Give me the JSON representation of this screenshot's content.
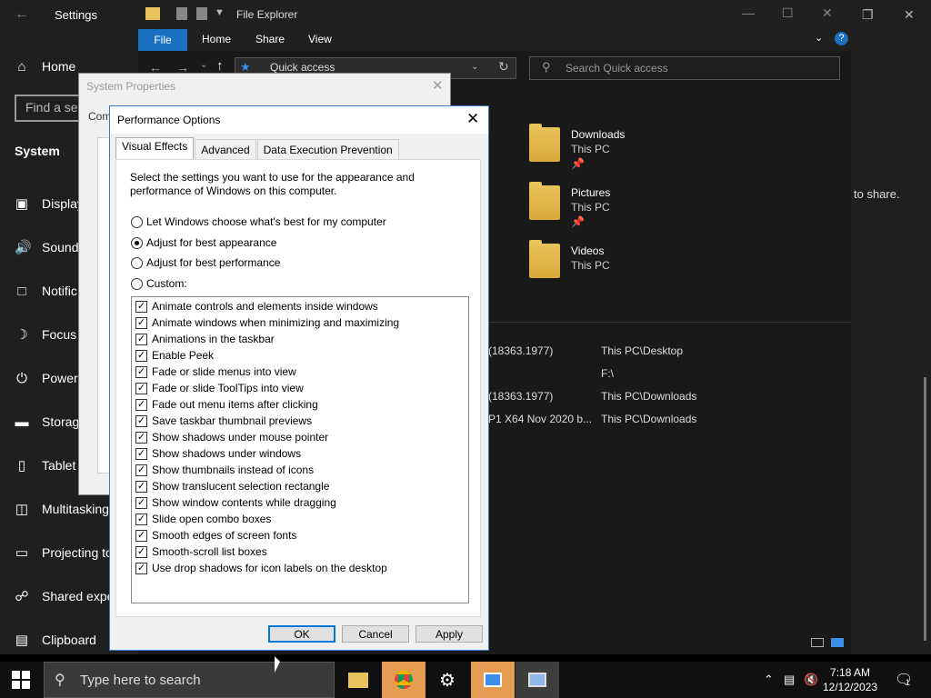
{
  "settings": {
    "title": "Settings",
    "home": "Home",
    "search_placeholder": "Find a set",
    "section": "System",
    "nav": [
      {
        "label": "Display",
        "icon": "display-icon"
      },
      {
        "label": "Sound",
        "icon": "sound-icon"
      },
      {
        "label": "Notific",
        "icon": "notifications-icon"
      },
      {
        "label": "Focus",
        "icon": "focus-assist-icon"
      },
      {
        "label": "Power",
        "icon": "power-icon"
      },
      {
        "label": "Storag",
        "icon": "storage-icon"
      },
      {
        "label": "Tablet",
        "icon": "tablet-icon"
      },
      {
        "label": "Multitasking",
        "icon": "multitasking-icon"
      },
      {
        "label": "Projecting to",
        "icon": "projecting-icon"
      },
      {
        "label": "Shared expe",
        "icon": "shared-experiences-icon"
      },
      {
        "label": "Clipboard",
        "icon": "clipboard-icon"
      }
    ],
    "share_hint": "to share."
  },
  "explorer": {
    "title": "File Explorer",
    "tabs": [
      "File",
      "Home",
      "Share",
      "View"
    ],
    "address": "Quick access",
    "search_placeholder": "Search Quick access",
    "folders": [
      {
        "name": "Downloads",
        "location": "This PC"
      },
      {
        "name": "Pictures",
        "location": "This PC"
      },
      {
        "name": "Videos",
        "location": "This PC"
      }
    ],
    "recent": [
      {
        "name": "(18363.1977)",
        "path": "This PC\\Desktop"
      },
      {
        "name": "",
        "path": "F:\\"
      },
      {
        "name": "(18363.1977)",
        "path": "This PC\\Downloads"
      },
      {
        "name": "P1 X64 Nov 2020 b...",
        "path": "This PC\\Downloads"
      }
    ]
  },
  "sysprops": {
    "title": "System Properties",
    "tab_stub": "Com"
  },
  "perf": {
    "title": "Performance Options",
    "tabs": [
      "Visual Effects",
      "Advanced",
      "Data Execution Prevention"
    ],
    "description": "Select the settings you want to use for the appearance and performance of Windows on this computer.",
    "radios": [
      {
        "label": "Let Windows choose what's best for my computer",
        "checked": false
      },
      {
        "label": "Adjust for best appearance",
        "checked": true
      },
      {
        "label": "Adjust for best performance",
        "checked": false
      },
      {
        "label": "Custom:",
        "checked": false
      }
    ],
    "effects": [
      "Animate controls and elements inside windows",
      "Animate windows when minimizing and maximizing",
      "Animations in the taskbar",
      "Enable Peek",
      "Fade or slide menus into view",
      "Fade or slide ToolTips into view",
      "Fade out menu items after clicking",
      "Save taskbar thumbnail previews",
      "Show shadows under mouse pointer",
      "Show shadows under windows",
      "Show thumbnails instead of icons",
      "Show translucent selection rectangle",
      "Show window contents while dragging",
      "Slide open combo boxes",
      "Smooth edges of screen fonts",
      "Smooth-scroll list boxes",
      "Use drop shadows for icon labels on the desktop"
    ],
    "buttons": {
      "ok": "OK",
      "cancel": "Cancel",
      "apply": "Apply"
    }
  },
  "taskbar": {
    "search_placeholder": "Type here to search",
    "time": "7:18 AM",
    "date": "12/12/2023",
    "notification_count": "1"
  },
  "colors": {
    "accent": "#0078d7",
    "explorer_file_tab": "#1a6fc1"
  }
}
